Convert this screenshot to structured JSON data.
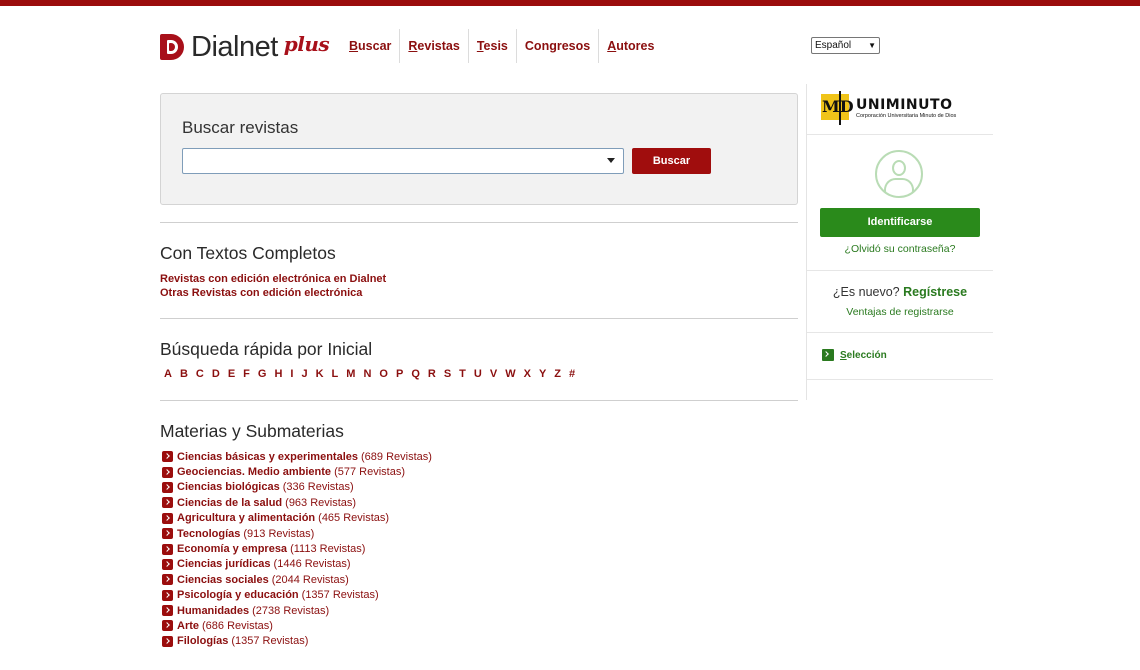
{
  "brand": {
    "name": "Dialnet",
    "plus": "plus"
  },
  "nav": [
    {
      "key": "B",
      "rest": "uscar"
    },
    {
      "key": "R",
      "rest": "evistas"
    },
    {
      "key": "T",
      "rest": "esis"
    },
    {
      "key": "Co",
      "rest": "ngresos",
      "underline_second": true
    },
    {
      "key": "A",
      "rest": "utores"
    }
  ],
  "nav_labels": [
    "Buscar",
    "Revistas",
    "Tesis",
    "Congresos",
    "Autores"
  ],
  "language": {
    "selected": "Español"
  },
  "search": {
    "title": "Buscar revistas",
    "value": "",
    "button": "Buscar"
  },
  "textos_completos": {
    "title": "Con Textos Completos",
    "links": [
      "Revistas con edición electrónica en Dialnet",
      "Otras Revistas con edición electrónica"
    ]
  },
  "busqueda_rapida": {
    "title": "Búsqueda rápida por Inicial",
    "letters": [
      "A",
      "B",
      "C",
      "D",
      "E",
      "F",
      "G",
      "H",
      "I",
      "J",
      "K",
      "L",
      "M",
      "N",
      "O",
      "P",
      "Q",
      "R",
      "S",
      "T",
      "U",
      "V",
      "W",
      "X",
      "Y",
      "Z",
      "#"
    ]
  },
  "materias": {
    "title": "Materias y Submaterias",
    "items": [
      {
        "name": "Ciencias básicas y experimentales",
        "count": "(689 Revistas)"
      },
      {
        "name": "Geociencias. Medio ambiente",
        "count": "(577 Revistas)"
      },
      {
        "name": "Ciencias biológicas",
        "count": "(336 Revistas)"
      },
      {
        "name": "Ciencias de la salud",
        "count": "(963 Revistas)"
      },
      {
        "name": "Agricultura y alimentación",
        "count": "(465 Revistas)"
      },
      {
        "name": "Tecnologías",
        "count": "(913 Revistas)"
      },
      {
        "name": "Economía y empresa",
        "count": "(1113 Revistas)"
      },
      {
        "name": "Ciencias jurídicas",
        "count": "(1446 Revistas)"
      },
      {
        "name": "Ciencias sociales",
        "count": "(2044 Revistas)"
      },
      {
        "name": "Psicología y educación",
        "count": "(1357 Revistas)"
      },
      {
        "name": "Humanidades",
        "count": "(2738 Revistas)"
      },
      {
        "name": "Arte",
        "count": "(686 Revistas)"
      },
      {
        "name": "Filologías",
        "count": "(1357 Revistas)"
      }
    ]
  },
  "sidebar": {
    "institution": {
      "name": "UNIMINUTO",
      "subtitle": "Corporación Universitaria Minuto de Dios",
      "mark": "MD"
    },
    "login_button": "Identificarse",
    "forgot": "¿Olvidó su contraseña?",
    "nuevo_prefix": "¿Es nuevo?",
    "register": "Regístrese",
    "ventajas": "Ventajas de registrarse",
    "seleccion": {
      "key": "S",
      "rest": "elección"
    }
  },
  "colors": {
    "brand_red": "#9b0d0d",
    "link_red": "#8b0f0f",
    "green": "#2a8a1b"
  }
}
